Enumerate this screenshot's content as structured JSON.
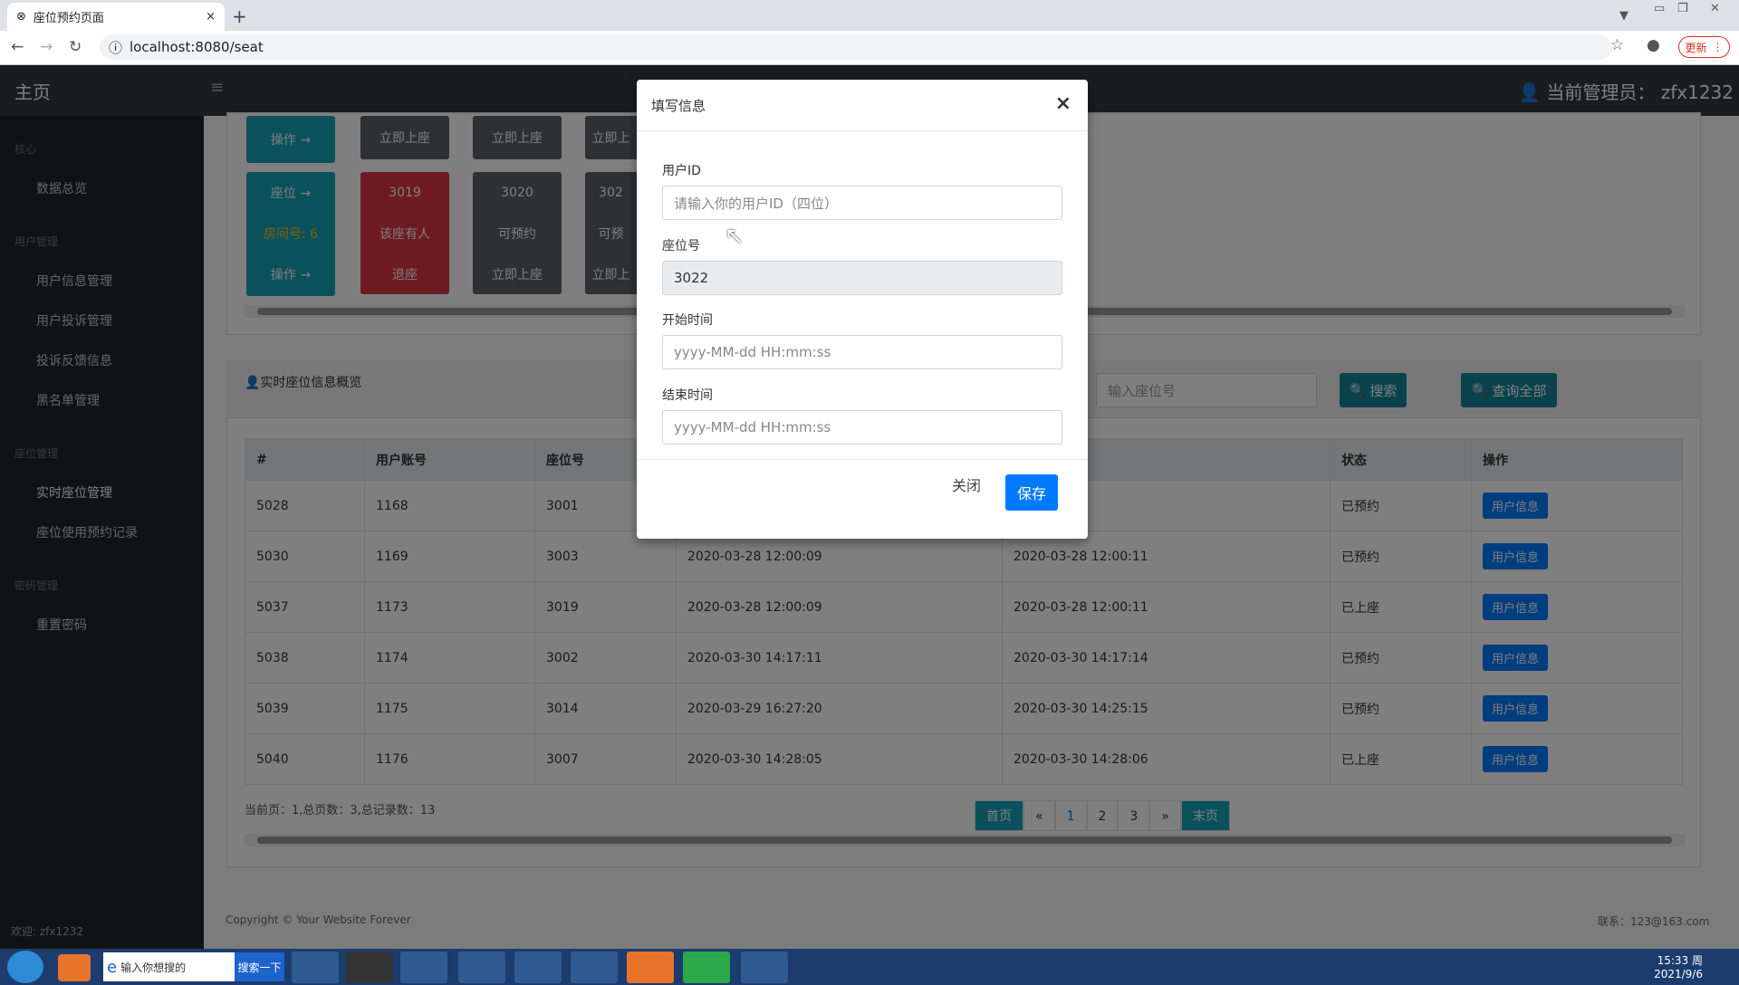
{
  "browser": {
    "tab_title": "座位预约页面",
    "url": "localhost:8080/seat",
    "update_label": "更新"
  },
  "app": {
    "brand": "主页",
    "admin_label": "当前管理员：",
    "admin_name": "zfx1232"
  },
  "sidebar": {
    "sections": [
      {
        "title": "核心",
        "items": [
          "数据总览"
        ]
      },
      {
        "title": "用户管理",
        "items": [
          "用户信息管理",
          "用户投诉管理",
          "投诉反馈信息",
          "黑名单管理"
        ]
      },
      {
        "title": "座位管理",
        "items": [
          "实时座位管理",
          "座位使用预约记录"
        ]
      },
      {
        "title": "密码管理",
        "items": [
          "重置密码"
        ]
      }
    ],
    "welcome": "欢迎: zfx1232"
  },
  "seats": {
    "row0": {
      "op": "操作 →",
      "b1": "立即上座",
      "b2": "立即上座",
      "b3": "立即上"
    },
    "col_labels": {
      "seat": "座位 →",
      "room": "房间号: 6",
      "op": "操作 →"
    },
    "s1": {
      "num": "3019",
      "status": "该座有人",
      "action": "退座"
    },
    "s2": {
      "num": "3020",
      "status": "可预约",
      "action": "立即上座"
    },
    "s3": {
      "num": "302",
      "status": "可预",
      "action": "立即上"
    }
  },
  "overview": {
    "title": "实时座位信息概览",
    "search_placeholder": "输入座位号",
    "search_btn": "搜索",
    "query_all_btn": "查询全部"
  },
  "table": {
    "headers": [
      "#",
      "用户账号",
      "座位号",
      "",
      "",
      "状态",
      "操作"
    ],
    "rows": [
      {
        "id": "5028",
        "user": "1168",
        "seat": "3001",
        "start": "",
        "end": "2:00:11",
        "status": "已预约",
        "op": "用户信息"
      },
      {
        "id": "5030",
        "user": "1169",
        "seat": "3003",
        "start": "2020-03-28 12:00:09",
        "end": "2020-03-28 12:00:11",
        "status": "已预约",
        "op": "用户信息"
      },
      {
        "id": "5037",
        "user": "1173",
        "seat": "3019",
        "start": "2020-03-28 12:00:09",
        "end": "2020-03-28 12:00:11",
        "status": "已上座",
        "op": "用户信息"
      },
      {
        "id": "5038",
        "user": "1174",
        "seat": "3002",
        "start": "2020-03-30 14:17:11",
        "end": "2020-03-30 14:17:14",
        "status": "已预约",
        "op": "用户信息"
      },
      {
        "id": "5039",
        "user": "1175",
        "seat": "3014",
        "start": "2020-03-29 16:27:20",
        "end": "2020-03-30 14:25:15",
        "status": "已预约",
        "op": "用户信息"
      },
      {
        "id": "5040",
        "user": "1176",
        "seat": "3007",
        "start": "2020-03-30 14:28:05",
        "end": "2020-03-30 14:28:06",
        "status": "已上座",
        "op": "用户信息"
      }
    ]
  },
  "pagination": {
    "summary": "当前页：1,总页数：3,总记录数：13",
    "first": "首页",
    "prev": "«",
    "pages": [
      "1",
      "2",
      "3"
    ],
    "next": "»",
    "last": "末页"
  },
  "footer": {
    "copyright": "Copyright © Your Website Forever",
    "contact": "联系：123@163.com"
  },
  "modal": {
    "title": "填写信息",
    "user_id_label": "用户ID",
    "user_id_placeholder": "请输入你的用户ID（四位）",
    "seat_label": "座位号",
    "seat_value": "3022",
    "start_label": "开始时间",
    "start_placeholder": "yyyy-MM-dd HH:mm:ss",
    "end_label": "结束时间",
    "end_placeholder": "yyyy-MM-dd HH:mm:ss",
    "close_btn": "关闭",
    "save_btn": "保存"
  },
  "taskbar": {
    "search_text": "输入你想搜的",
    "search_go": "搜索一下",
    "time": "15:33 周",
    "date": "2021/9/6"
  }
}
